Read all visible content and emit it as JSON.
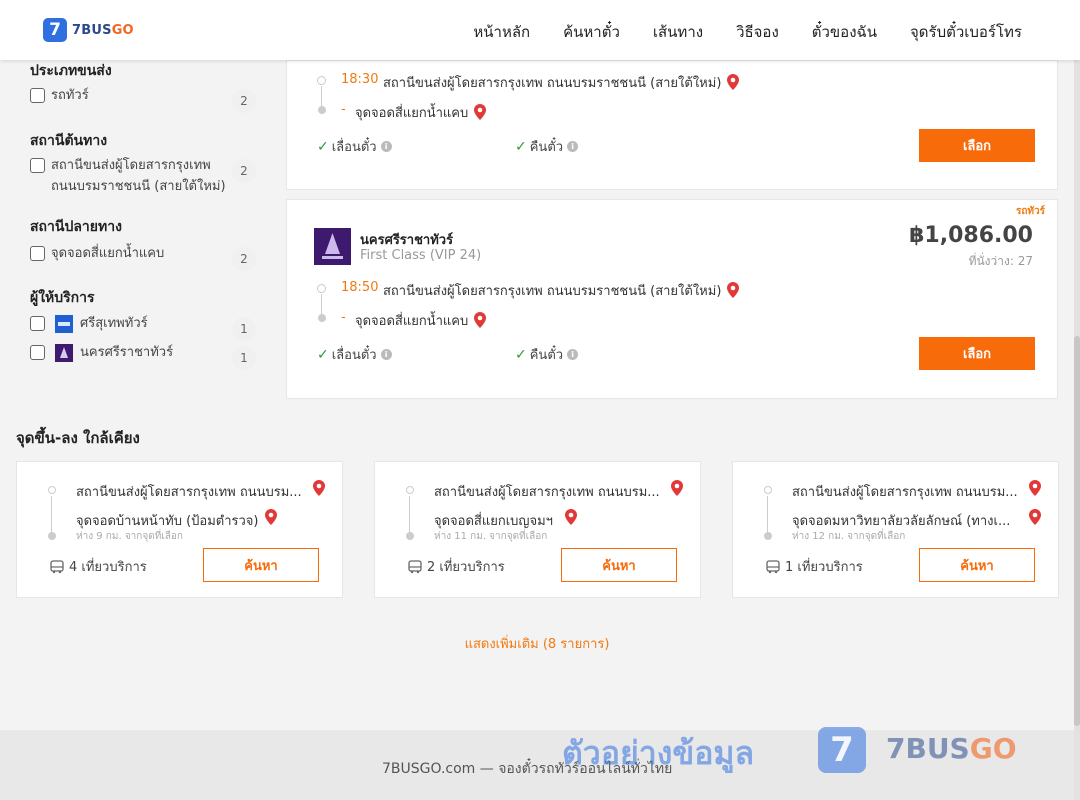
{
  "brand": {
    "logo_glyph": "7",
    "name_main": "7BUS",
    "name_accent": "GO"
  },
  "nav": {
    "items": [
      "หน้าหลัก",
      "ค้นหาตั๋ว",
      "เส้นทาง",
      "วิธีจอง",
      "ตั๋วของฉัน",
      "จุดรับตั๋วเบอร์โทร"
    ]
  },
  "filters": {
    "type": {
      "title": "ประเภทขนส่ง",
      "items": [
        {
          "label": "รถทัวร์",
          "count": "2"
        }
      ]
    },
    "origin": {
      "title": "สถานีต้นทาง",
      "items": [
        {
          "label_line1": "สถานีขนส่งผู้โดยสารกรุงเทพ",
          "label_line2": "ถนนบรมราชชนนี (สายใต้ใหม่)",
          "count": "2"
        }
      ]
    },
    "destination": {
      "title": "สถานีปลายทาง",
      "items": [
        {
          "label": "จุดจอดสี่แยกน้ำแคบ",
          "count": "2"
        }
      ]
    },
    "operator": {
      "title": "ผู้ให้บริการ",
      "items": [
        {
          "label": "ศรีสุเทพทัวร์",
          "count": "1"
        },
        {
          "label": "นครศรีราชาทัวร์",
          "count": "1"
        }
      ]
    }
  },
  "card1": {
    "time": "18:30",
    "from": "สถานีขนส่งผู้โดยสารกรุงเทพ ถนนบรมราชชนนี (สายใต้ใหม่)",
    "dash": "-",
    "to": "จุดจอดสี่แยกน้ำแคบ",
    "feature1": "เลื่อนตั๋ว",
    "feature2": "คืนตั๋ว",
    "button": "เลือก"
  },
  "card2": {
    "tag": "รถทัวร์",
    "operator": "นครศรีราชาทัวร์",
    "class": "First Class (VIP 24)",
    "price": "฿1,086.00",
    "seats": "ที่นั่งว่าง: 27",
    "time": "18:50",
    "from": "สถานีขนส่งผู้โดยสารกรุงเทพ ถนนบรมราชชนนี (สายใต้ใหม่)",
    "dash": "-",
    "to": "จุดจอดสี่แยกน้ำแคบ",
    "feature1": "เลื่อนตั๋ว",
    "feature2": "คืนตั๋ว",
    "button": "เลือก"
  },
  "nearby": {
    "title": "จุดขึ้น-ลง ใกล้เคียง",
    "cards": [
      {
        "from": "สถานีขนส่งผู้โดยสารกรุงเทพ ถนนบรม...",
        "to": "จุดจอดบ้านหน้าทับ (ป้อมตำรวจ)",
        "distance": "ห่าง 9 กม. จากจุดที่เลือก",
        "trips": "4 เที่ยวบริการ",
        "button": "ค้นหา"
      },
      {
        "from": "สถานีขนส่งผู้โดยสารกรุงเทพ ถนนบรม...",
        "to": "จุดจอดสี่แยกเบญจมฯ",
        "distance": "ห่าง 11 กม. จากจุดที่เลือก",
        "trips": "2 เที่ยวบริการ",
        "button": "ค้นหา"
      },
      {
        "from": "สถานีขนส่งผู้โดยสารกรุงเทพ ถนนบรม...",
        "to": "จุดจอดมหาวิทยาลัยวลัยลักษณ์ (ทางเ...",
        "distance": "ห่าง 12 กม. จากจุดที่เลือก",
        "trips": "1 เที่ยวบริการ",
        "button": "ค้นหา"
      }
    ],
    "show_more": "แสดงเพิ่มเติม (8 รายการ)"
  },
  "footer": {
    "text": "7BUSGO.com — จองตั๋วรถทัวร์ออนไลน์ทั่วไทย"
  },
  "watermark": {
    "text": "ตัวอย่างข้อมูล",
    "logo_glyph": "7",
    "brand_main": "7BUS",
    "brand_accent": "GO"
  },
  "colors": {
    "accent": "#f76b0a",
    "brand_blue": "#2f6fe0",
    "check": "#2e9b2e",
    "pin": "#e23838"
  }
}
